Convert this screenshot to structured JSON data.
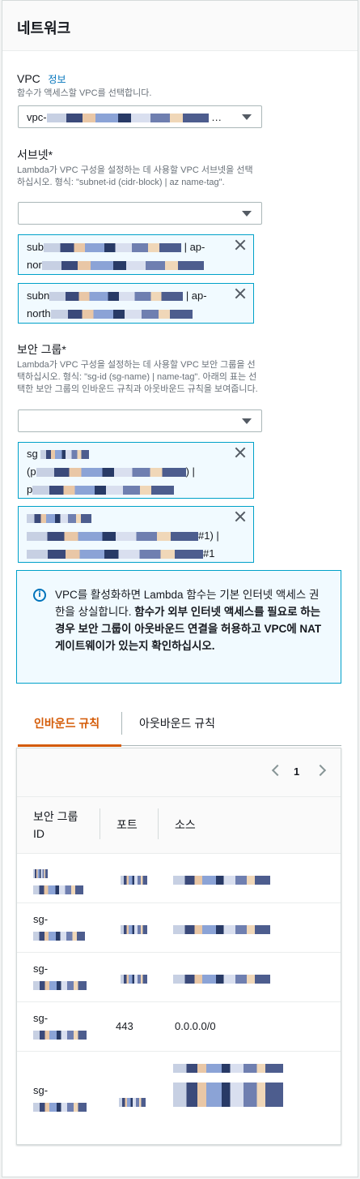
{
  "panel": {
    "title": "네트워크"
  },
  "vpc": {
    "label": "VPC",
    "info_link": "정보",
    "description": "함수가 액세스할 VPC를 선택합니다.",
    "selected_prefix": "vpc-"
  },
  "subnets": {
    "label": "서브넷*",
    "description": "Lambda가 VPC 구성을 설정하는 데 사용할 VPC 서브넷을 선택하십시오. 형식: \"subnet-id (cidr-block) | az name-tag\".",
    "tokens": [
      {
        "prefix": "sub",
        "mid": " | ap-",
        "line2": "nor"
      },
      {
        "prefix": "subn",
        "mid": " | ap-",
        "line2": "north"
      }
    ]
  },
  "security_groups": {
    "label": "보안 그룹*",
    "description": "Lambda가 VPC 구성을 설정하는 데 사용할 VPC 보안 그룹을 선택하십시오. 형식: \"sg-id (sg-name) | name-tag\". 아래의 표는 선택한 보안 그룹의 인바운드 규칙과 아웃바운드 규칙을 보여줍니다.",
    "tokens": [
      {
        "line1": "sg",
        "line2_prefix": "(p",
        "line2_suffix": ") |",
        "line3": "p"
      },
      {
        "line1": "",
        "line2_suffix": "#1) |",
        "line3_suffix": "#1"
      }
    ]
  },
  "alert": {
    "text_plain": "VPC를 활성화하면 Lambda 함수는 기본 인터넷 액세스 권한을 상실합니다. ",
    "text_bold": "함수가 외부 인터넷 액세스를 필요로 하는 경우 보안 그룹이 아웃바운드 연결을 허용하고 VPC에 NAT 게이트웨이가 있는지 확인하십시오."
  },
  "tabs": [
    {
      "label": "인바운드 규칙",
      "active": true
    },
    {
      "label": "아웃바운드 규칙",
      "active": false
    }
  ],
  "pagination": {
    "current_page": "1"
  },
  "table": {
    "columns": [
      "보안 그룹 ID",
      "포트",
      "소스"
    ],
    "rows": [
      {
        "sg_id": "sg-",
        "port": "",
        "source": ""
      },
      {
        "sg_id": "sg-",
        "port": "",
        "source": ""
      },
      {
        "sg_id": "sg-",
        "port": "",
        "source": ""
      },
      {
        "sg_id": "sg-",
        "port": "443",
        "source": "0.0.0.0/0"
      },
      {
        "sg_id": "sg-",
        "port": "",
        "source": ""
      }
    ]
  },
  "colors": {
    "accent_orange": "#d45b07",
    "link_blue": "#0073bb",
    "token_border": "#00a1c9",
    "token_bg": "#f1faff"
  }
}
